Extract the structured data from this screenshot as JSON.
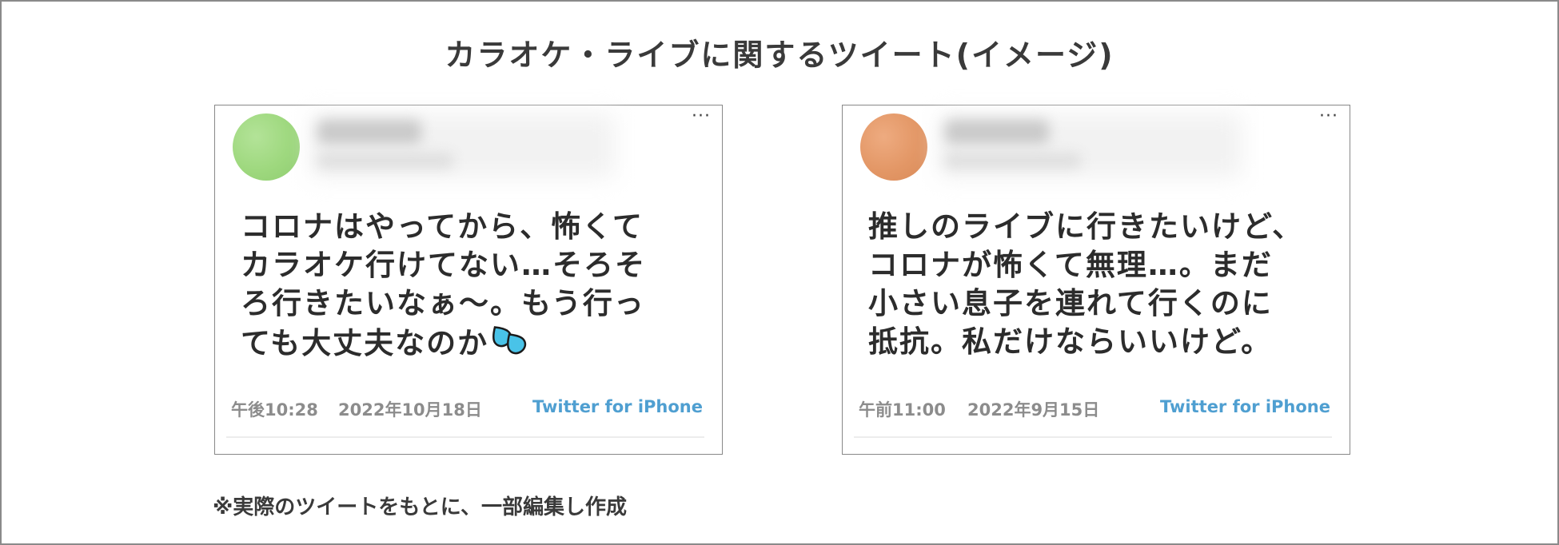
{
  "page": {
    "title": "カラオケ・ライブに関するツイート(イメージ)",
    "footnote": "※実際のツイートをもとに、一部編集し作成"
  },
  "tweets": [
    {
      "avatar_color": "#9ed87e",
      "text_lines": [
        "コロナはやってから、怖くて",
        "カラオケ行けてない…そろそ",
        "ろ行きたいなぁ～。もう行っ",
        "ても大丈夫なのか"
      ],
      "emoji_icon": "sweat-drops-icon",
      "time": "午後10:28",
      "date": "2022年10月18日",
      "source": "Twitter for iPhone"
    },
    {
      "avatar_color": "#e39766",
      "text_lines": [
        "推しのライブに行きたいけど、",
        "コロナが怖くて無理…。まだ",
        "小さい息子を連れて行くのに",
        "抵抗。私だけならいいけど。"
      ],
      "time": "午前11:00",
      "date": "2022年9月15日",
      "source": "Twitter for iPhone"
    }
  ],
  "colors": {
    "source_link": "#4f9fd1",
    "meta_text": "#8c8c8c",
    "body_text": "#2c2c2c"
  }
}
